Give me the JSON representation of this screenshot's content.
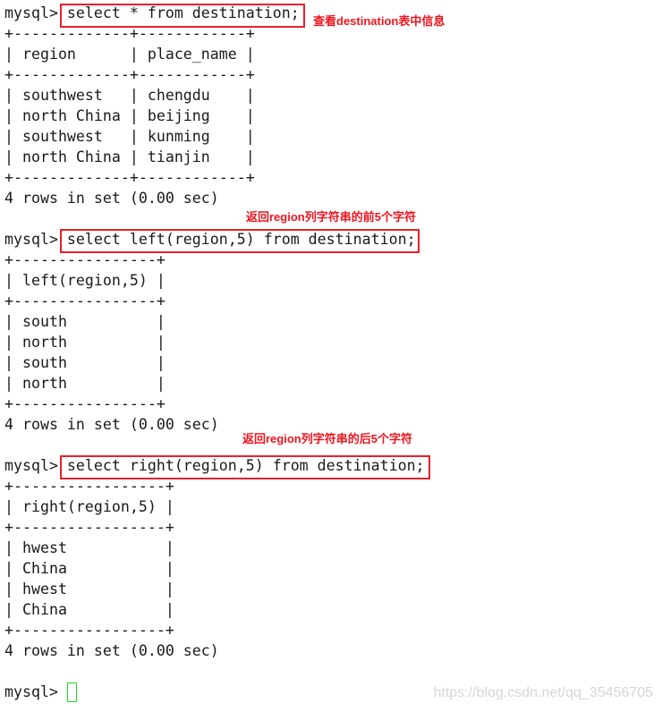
{
  "terminal": {
    "lines": [
      "mysql> select * from destination;",
      "+-------------+------------+",
      "| region      | place_name |",
      "+-------------+------------+",
      "| southwest   | chengdu    |",
      "| north China | beijing    |",
      "| southwest   | kunming    |",
      "| north China | tianjin    |",
      "+-------------+------------+",
      "4 rows in set (0.00 sec)",
      "",
      "mysql> select left(region,5) from destination;",
      "+----------------+",
      "| left(region,5) |",
      "+----------------+",
      "| south          |",
      "| north          |",
      "| south          |",
      "| north          |",
      "+----------------+",
      "4 rows in set (0.00 sec)",
      "",
      "mysql> select right(region,5) from destination;",
      "+-----------------+",
      "| right(region,5) |",
      "+-----------------+",
      "| hwest           |",
      "| China           |",
      "| hwest           |",
      "| China           |",
      "+-----------------+",
      "4 rows in set (0.00 sec)",
      "",
      "mysql> "
    ]
  },
  "annotations": [
    "查看destination表中信息",
    "返回region列字符串的前5个字符",
    "返回region列字符串的后5个字符"
  ],
  "watermark": "https://blog.csdn.net/qq_35456705",
  "colors": {
    "highlight_box": "#e8202a",
    "annotation": "#f0141e",
    "cursor": "#22dd22"
  }
}
